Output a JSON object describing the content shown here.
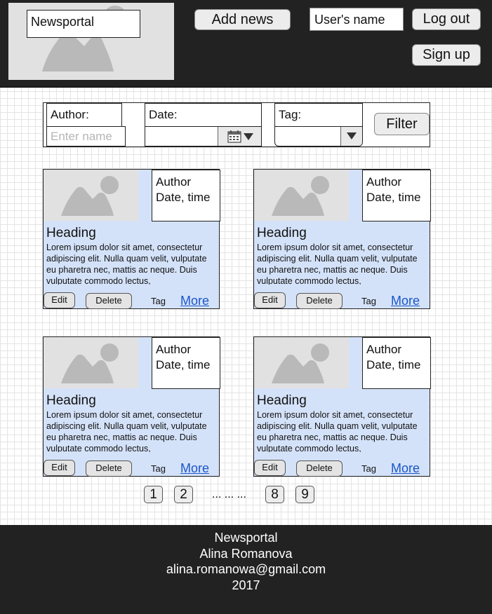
{
  "header": {
    "site_name": "Newsportal",
    "add_news_label": "Add news",
    "user_name": "User's name",
    "logout_label": "Log out",
    "signup_label": "Sign up"
  },
  "filter": {
    "author_label": "Author:",
    "author_placeholder": "Enter name",
    "date_label": "Date:",
    "tag_label": "Tag:",
    "filter_button": "Filter"
  },
  "cards": [
    {
      "author": "Author",
      "datetime": "Date, time",
      "heading": "Heading",
      "text": "Lorem ipsum dolor sit amet, consectetur adipiscing elit. Nulla quam velit, vulputate eu pharetra nec, mattis ac neque. Duis vulputate commodo lectus,",
      "edit": "Edit",
      "delete": "Delete",
      "tag": "Tag",
      "more": "More"
    },
    {
      "author": "Author",
      "datetime": "Date, time",
      "heading": "Heading",
      "text": "Lorem ipsum dolor sit amet, consectetur adipiscing elit. Nulla quam velit, vulputate eu pharetra nec, mattis ac neque. Duis vulputate commodo lectus,",
      "edit": "Edit",
      "delete": "Delete",
      "tag": "Tag",
      "more": "More"
    },
    {
      "author": "Author",
      "datetime": "Date, time",
      "heading": "Heading",
      "text": "Lorem ipsum dolor sit amet, consectetur adipiscing elit. Nulla quam velit, vulputate eu pharetra nec, mattis ac neque. Duis vulputate commodo lectus,",
      "edit": "Edit",
      "delete": "Delete",
      "tag": "Tag",
      "more": "More"
    },
    {
      "author": "Author",
      "datetime": "Date, time",
      "heading": "Heading",
      "text": "Lorem ipsum dolor sit amet, consectetur adipiscing elit. Nulla quam velit, vulputate eu pharetra nec, mattis ac neque. Duis vulputate commodo lectus,",
      "edit": "Edit",
      "delete": "Delete",
      "tag": "Tag",
      "more": "More"
    }
  ],
  "pagination": {
    "pages": [
      "1",
      "2",
      "8",
      "9"
    ],
    "ellipsis": "... ... ..."
  },
  "footer": {
    "lines": [
      "Newsportal",
      "Alina Romanova",
      "alina.romanowa@gmail.com",
      "2017"
    ]
  },
  "icons": {
    "image_placeholder": "image-placeholder-icon",
    "calendar": "calendar-icon",
    "dropdown": "chevron-down-icon"
  },
  "colors": {
    "header_bg": "#222222",
    "card_bg": "#d4e2f9",
    "link": "#1a56c8"
  }
}
